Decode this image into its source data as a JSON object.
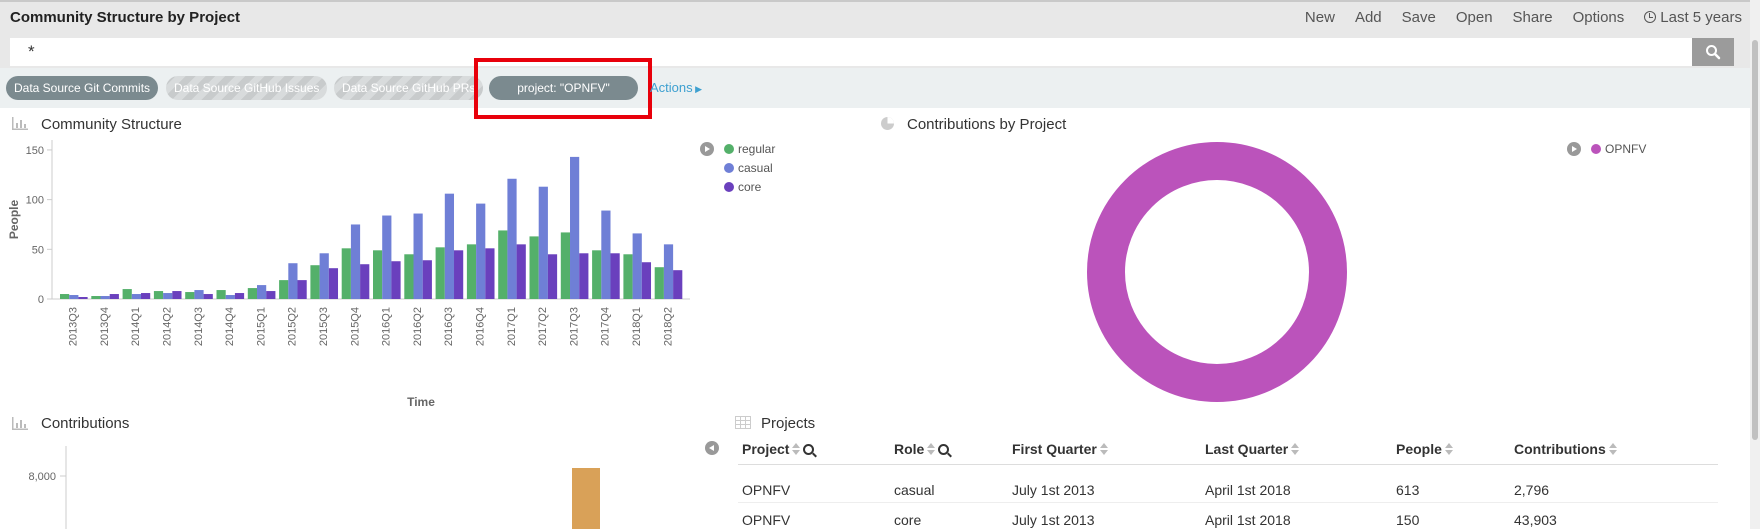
{
  "app": {
    "title": "Community Structure by Project"
  },
  "menu": {
    "new": "New",
    "add": "Add",
    "save": "Save",
    "open": "Open",
    "share": "Share",
    "options": "Options",
    "time": "Last 5 years"
  },
  "query": {
    "value": "*"
  },
  "filters": [
    {
      "label": "Data Source Git Commits",
      "state": "active"
    },
    {
      "label": "Data Source GitHub Issues",
      "state": "disabled"
    },
    {
      "label": "Data Source GitHub PRs",
      "state": "disabled"
    },
    {
      "label": "project: \"OPNFV\"",
      "state": "active"
    }
  ],
  "actions_label": "Actions",
  "panels": {
    "community": {
      "title": "Community Structure"
    },
    "contrib_by_project": {
      "title": "Contributions by Project"
    },
    "contributions": {
      "title": "Contributions"
    },
    "projects": {
      "title": "Projects"
    }
  },
  "chart_data": [
    {
      "type": "bar",
      "xlabel": "Time",
      "ylabel": "People",
      "ylim": [
        0,
        160
      ],
      "yticks": [
        "0",
        "50",
        "100",
        "150"
      ],
      "categories": [
        "2013Q3",
        "2013Q4",
        "2014Q1",
        "2014Q2",
        "2014Q3",
        "2014Q4",
        "2015Q1",
        "2015Q2",
        "2015Q3",
        "2015Q4",
        "2016Q1",
        "2016Q2",
        "2016Q3",
        "2016Q4",
        "2017Q1",
        "2017Q2",
        "2017Q3",
        "2017Q4",
        "2018Q1",
        "2018Q2"
      ],
      "series": [
        {
          "name": "regular",
          "color": "#54b06a",
          "values": [
            5,
            3,
            10,
            8,
            7,
            9,
            11,
            19,
            34,
            51,
            49,
            45,
            52,
            55,
            69,
            63,
            67,
            49,
            45,
            32
          ]
        },
        {
          "name": "casual",
          "color": "#6f7fd6",
          "values": [
            4,
            3,
            5,
            6,
            9,
            4,
            14,
            36,
            46,
            75,
            84,
            86,
            106,
            96,
            121,
            113,
            143,
            89,
            66,
            55
          ]
        },
        {
          "name": "core",
          "color": "#6a40bd",
          "values": [
            2,
            5,
            6,
            8,
            5,
            6,
            8,
            19,
            31,
            35,
            38,
            39,
            49,
            51,
            55,
            45,
            46,
            46,
            37,
            29
          ]
        }
      ],
      "legend": "top-right"
    },
    {
      "type": "pie",
      "donut": true,
      "labels": [
        "OPNFV"
      ],
      "values": [
        100
      ],
      "colors": [
        "#bb53bb"
      ],
      "legend": "top-right"
    },
    {
      "type": "bar",
      "ytick_visible": "8,000",
      "color": "#d9a158",
      "visible_value_estimate": 8300
    }
  ],
  "table": {
    "headers": {
      "project": "Project",
      "role": "Role",
      "first": "First Quarter",
      "last": "Last Quarter",
      "people": "People",
      "contributions": "Contributions"
    },
    "rows": [
      {
        "project": "OPNFV",
        "role": "casual",
        "first": "July 1st 2013",
        "last": "April 1st 2018",
        "people": "613",
        "contributions": "2,796"
      },
      {
        "project": "OPNFV",
        "role": "core",
        "first": "July 1st 2013",
        "last": "April 1st 2018",
        "people": "150",
        "contributions": "43,903"
      }
    ]
  }
}
